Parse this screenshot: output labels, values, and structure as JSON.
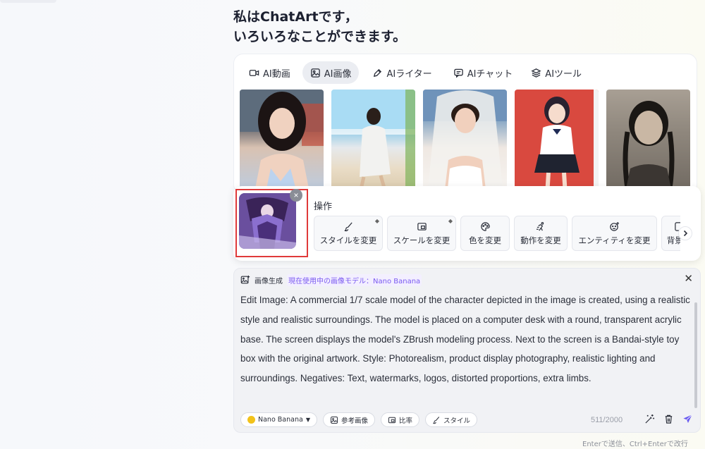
{
  "headline": {
    "line1": "私はChatArtです，",
    "line2": "いろいろなことができます。"
  },
  "feature_tabs": [
    {
      "label": "AI動画",
      "icon": "video-icon",
      "active": false
    },
    {
      "label": "AI画像",
      "icon": "image-icon",
      "active": true
    },
    {
      "label": "AIライター",
      "icon": "pen-icon",
      "active": false
    },
    {
      "label": "AIチャット",
      "icon": "chat-icon",
      "active": false
    },
    {
      "label": "AIツール",
      "icon": "layers-icon",
      "active": false
    }
  ],
  "sample_images": [
    {
      "icon": "portrait-woman-city-image"
    },
    {
      "icon": "woman-beach-image"
    },
    {
      "icon": "bride-veil-image"
    },
    {
      "icon": "anime-schoolgirl-image"
    },
    {
      "icon": "vintage-portrait-image"
    }
  ],
  "operations": {
    "title": "操作",
    "buttons": [
      {
        "label": "スタイルを変更",
        "icon": "brush-icon",
        "pro": true
      },
      {
        "label": "スケールを変更",
        "icon": "scale-icon",
        "pro": true
      },
      {
        "label": "色を変更",
        "icon": "palette-icon",
        "pro": false
      },
      {
        "label": "動作を変更",
        "icon": "motion-icon",
        "pro": false
      },
      {
        "label": "エンティティを変更",
        "icon": "smiley-plus-icon",
        "pro": false
      },
      {
        "label": "背景を",
        "icon": "background-icon",
        "pro": false
      }
    ],
    "pro_mark": "◆"
  },
  "editor": {
    "mode_label": "画像生成",
    "model_label": "現在使用中の画像モデル：Nano Banana",
    "prompt": "Edit  Image: A commercial 1/7 scale model of the character depicted in the image is created, using a realistic style and realistic surroundings. The model is placed on a computer desk with a round, transparent acrylic base. The screen displays the model's ZBrush modeling process. Next to the screen is a Bandai-style toy box with the original artwork. Style: Photorealism, product display photography, realistic lighting and surroundings. Negatives: Text, watermarks, logos, distorted proportions, extra limbs.",
    "chips": {
      "model": "Nano Banana",
      "reference": "参考画像",
      "ratio": "比率",
      "style": "スタイル"
    },
    "counter": "511/2000",
    "hint": "Enterで送信、Ctrl+Enterで改行"
  },
  "colors": {
    "accent": "#7a5af0",
    "highlight_border": "#e03a3a",
    "send": "#6b5cf0"
  }
}
